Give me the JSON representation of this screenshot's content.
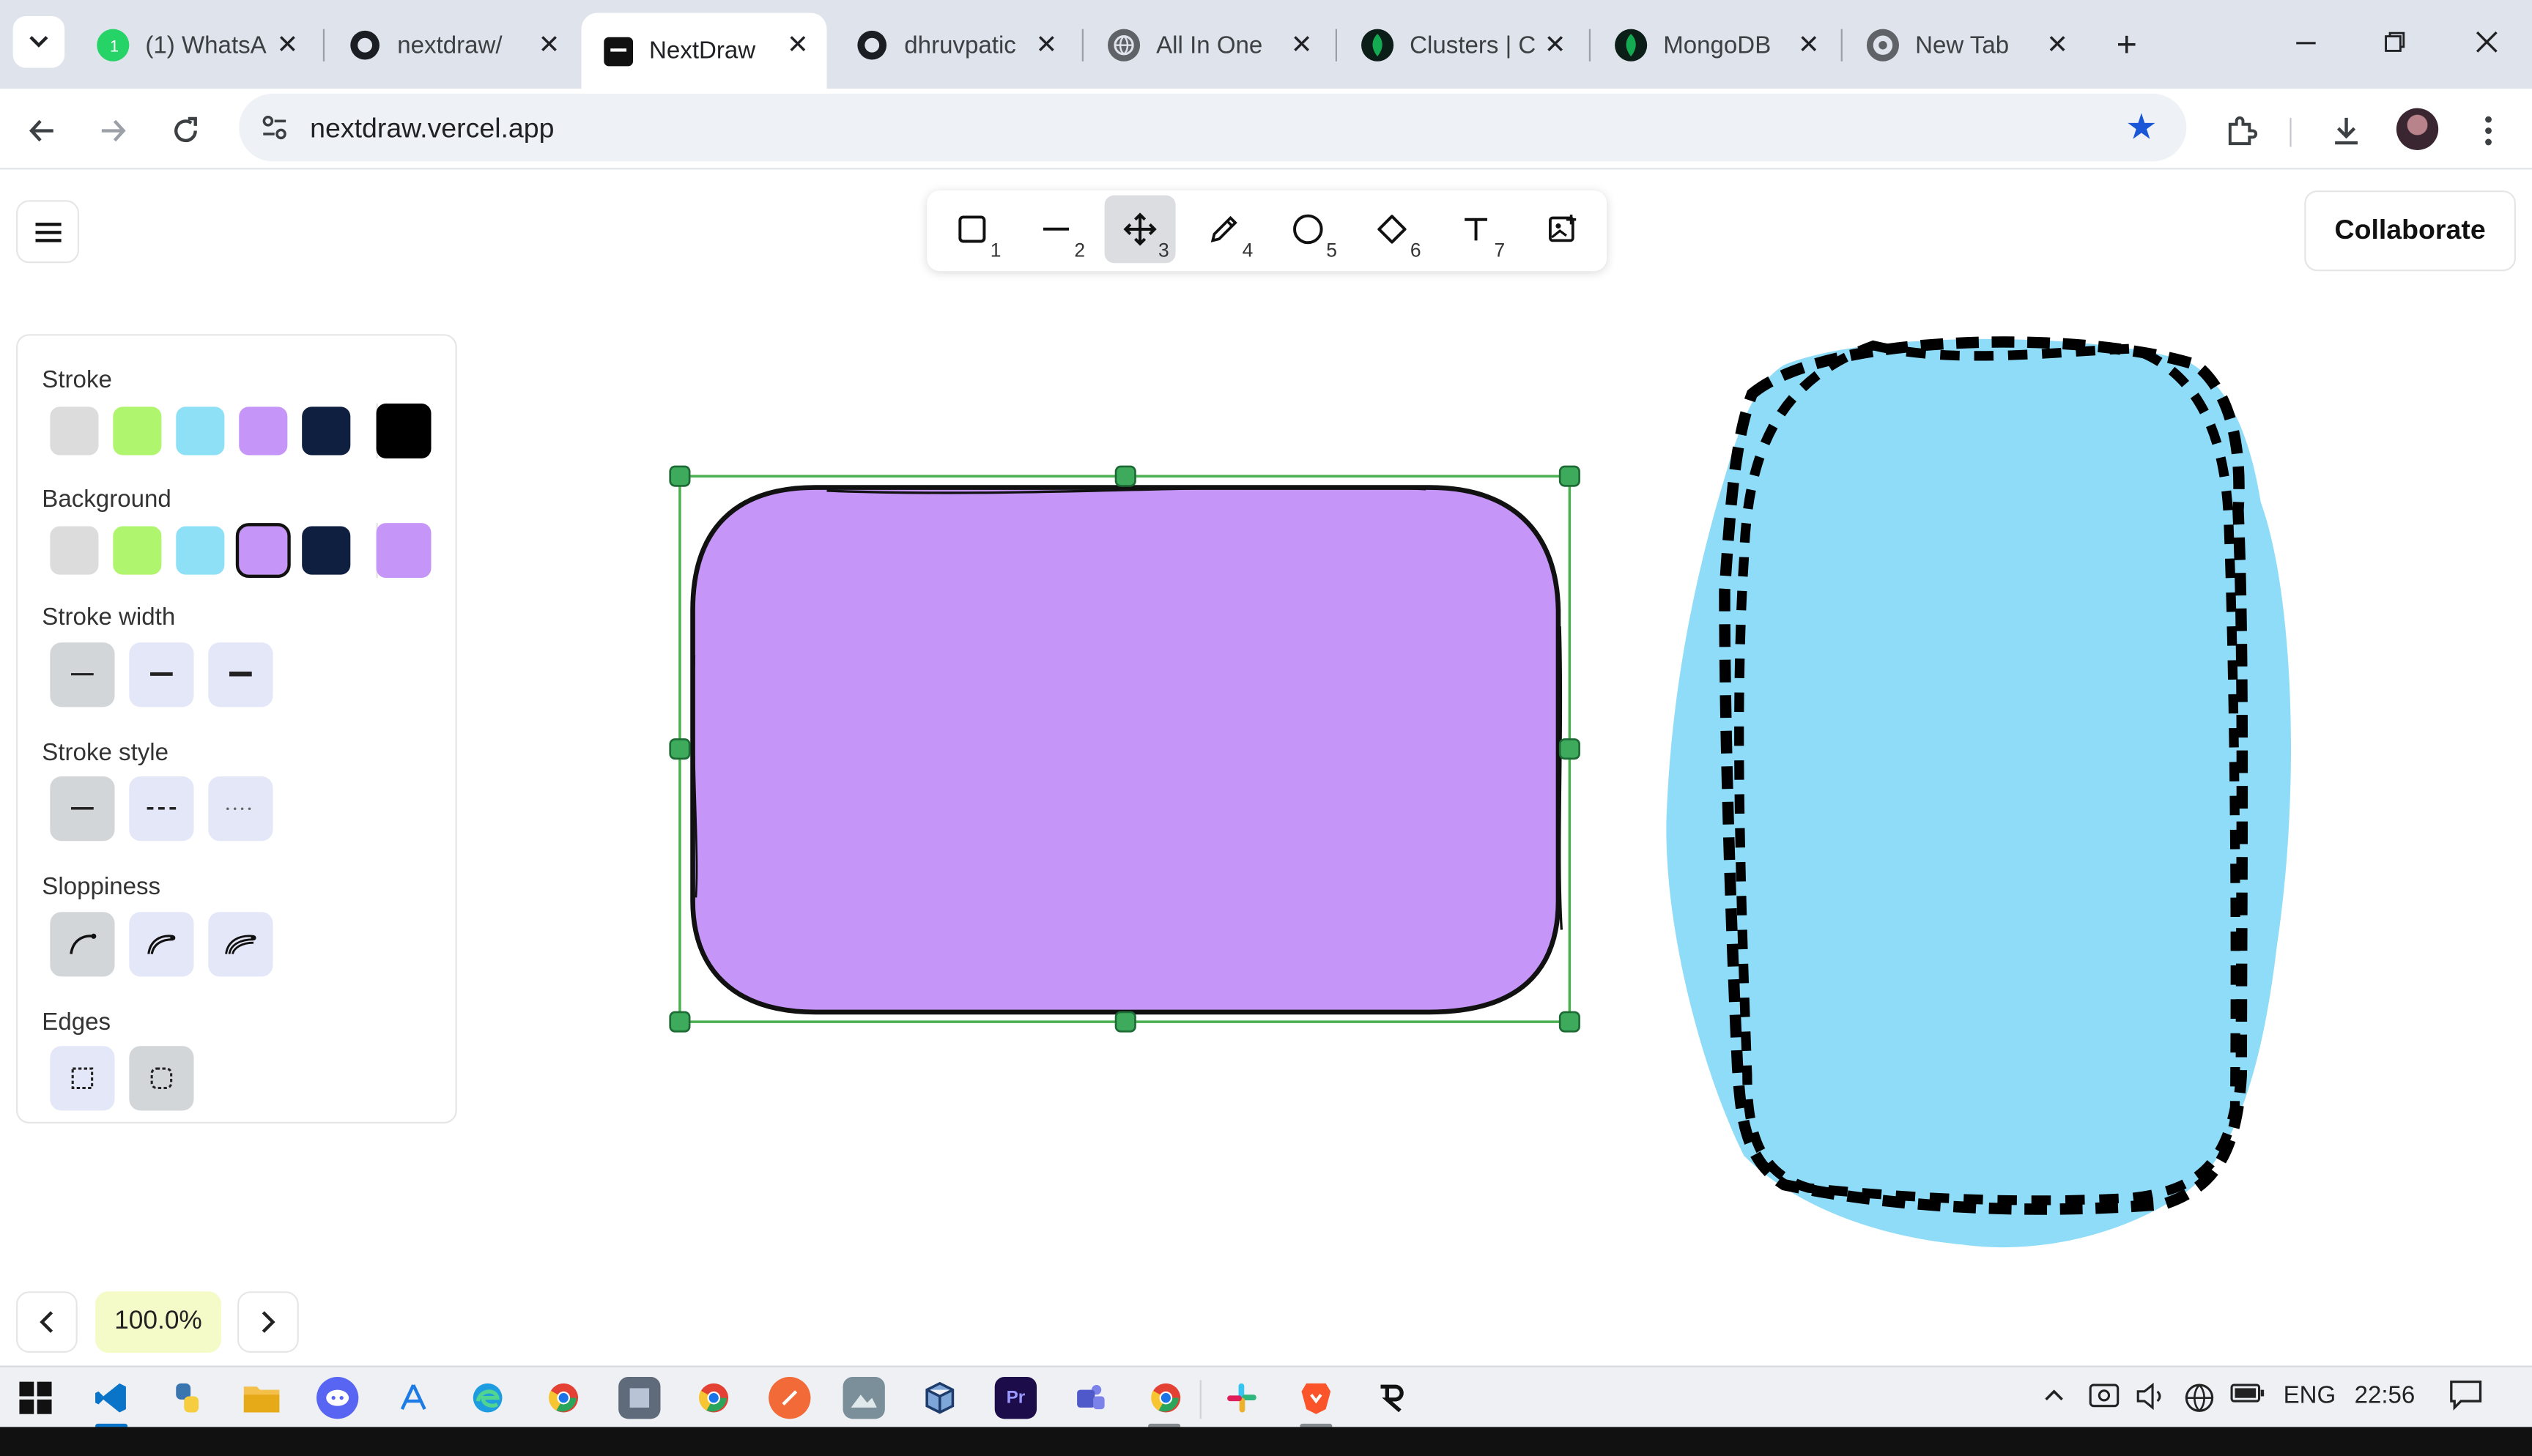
{
  "browser": {
    "tabs": [
      {
        "title": "(1) WhatsA",
        "icon": "whatsapp-icon",
        "active": false
      },
      {
        "title": "nextdraw/",
        "icon": "github-icon",
        "active": false
      },
      {
        "title": "NextDraw",
        "icon": "nextdraw-icon",
        "active": true
      },
      {
        "title": "dhruvpatic",
        "icon": "github-icon",
        "active": false
      },
      {
        "title": "All In One",
        "icon": "globe-icon",
        "active": false
      },
      {
        "title": "Clusters | C",
        "icon": "mongodb-icon",
        "active": false
      },
      {
        "title": "MongoDB",
        "icon": "mongodb-icon",
        "active": false
      },
      {
        "title": "New Tab",
        "icon": "chrome-icon",
        "active": false
      }
    ],
    "url": "nextdraw.vercel.app"
  },
  "tools": [
    {
      "num": "1",
      "icon": "rectangle-icon"
    },
    {
      "num": "2",
      "icon": "line-icon"
    },
    {
      "num": "3",
      "icon": "move-icon",
      "selected": true
    },
    {
      "num": "4",
      "icon": "pencil-icon"
    },
    {
      "num": "5",
      "icon": "circle-icon"
    },
    {
      "num": "6",
      "icon": "diamond-icon"
    },
    {
      "num": "7",
      "icon": "text-icon"
    },
    {
      "icon": "image-icon"
    }
  ],
  "collaborate_label": "Collaborate",
  "panel": {
    "stroke_label": "Stroke",
    "stroke_colors": [
      "#dcdcdc",
      "#b0f56e",
      "#8ee0f7",
      "#c596f7",
      "#0f1f3f"
    ],
    "stroke_current": "#000000",
    "background_label": "Background",
    "background_colors": [
      "#dcdcdc",
      "#b0f56e",
      "#8ee0f7",
      "#c596f7",
      "#0f1f3f"
    ],
    "background_selected": "#c596f7",
    "background_current": "#c596f7",
    "stroke_width_label": "Stroke width",
    "stroke_style_label": "Stroke style",
    "sloppiness_label": "Sloppiness",
    "edges_label": "Edges"
  },
  "zoom": {
    "value": "100.0%"
  },
  "taskbar": {
    "language": "ENG",
    "time": "22:56"
  }
}
